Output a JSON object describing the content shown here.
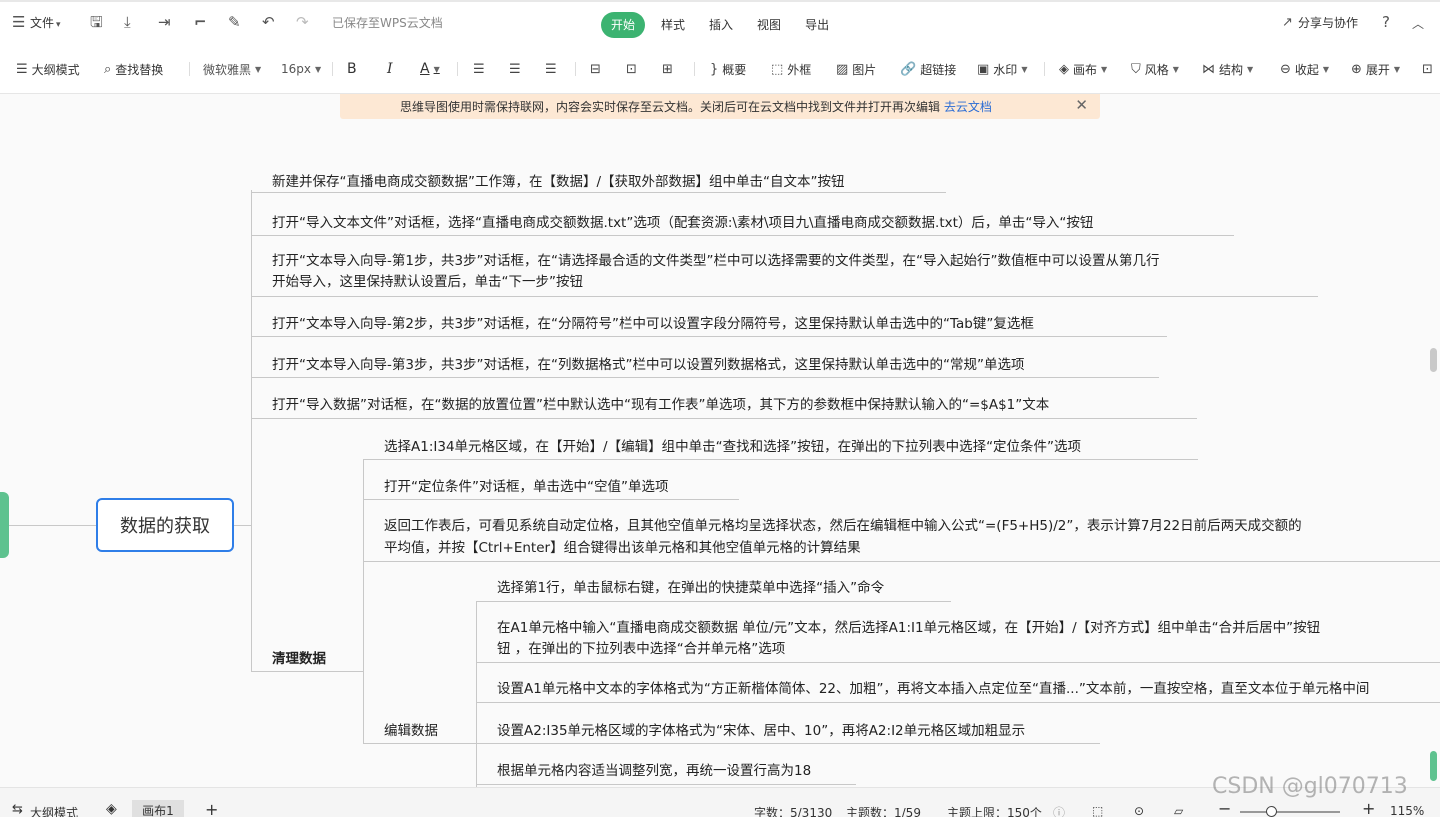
{
  "menubar": {
    "file_menu": "文件",
    "save_status": "已保存至WPS云文档",
    "tabs": [
      "开始",
      "样式",
      "插入",
      "视图",
      "导出"
    ],
    "share": "分享与协作"
  },
  "toolbar": {
    "outline_mode": "大纲模式",
    "find_replace": "查找替换",
    "font_name": "微软雅黑",
    "font_size": "16px",
    "bold": "B",
    "italic": "I",
    "font_color": "A",
    "summary": "概要",
    "frame": "外框",
    "image": "图片",
    "hyperlink": "超链接",
    "watermark": "水印",
    "canvas": "画布",
    "style": "风格",
    "structure": "结构",
    "collapse": "收起",
    "expand": "展开"
  },
  "notice": {
    "text": "思维导图使用时需保持联网，内容会实时保存至云文档。关闭后可在云文档中找到文件并打开再次编辑 ",
    "link": "去云文档"
  },
  "mindmap": {
    "root": "数据的获取",
    "level1_label": "清理数据",
    "level2_label": "编辑数据",
    "top_nodes": [
      "新建并保存“直播电商成交额数据”工作簿，在【数据】/【获取外部数据】组中单击“自文本”按钮",
      "打开“导入文本文件”对话框，选择“直播电商成交额数据.txt”选项（配套资源:\\素材\\项目九\\直播电商成交额数据.txt）后，单击“导入“按钮",
      "打开“文本导入向导-第1步，共3步”对话框，在“请选择最合适的文件类型”栏中可以选择需要的文件类型，在“导入起始行”数值框中可以设置从第几行",
      "开始导入，这里保持默认设置后，单击“下一步”按钮",
      "打开“文本导入向导-第2步，共3步”对话框，在“分隔符号”栏中可以设置字段分隔符号，这里保持默认单击选中的“Tab键”复选框",
      "打开“文本导入向导-第3步，共3步”对话框，在“列数据格式”栏中可以设置列数据格式，这里保持默认单击选中的“常规”单选项",
      "打开“导入数据”对话框，在“数据的放置位置”栏中默认选中“现有工作表”单选项，其下方的参数框中保持默认输入的“=$A$1”文本"
    ],
    "clean_nodes": [
      "选择A1:I34单元格区域，在【开始】/【编辑】组中单击“查找和选择”按钮，在弹出的下拉列表中选择“定位条件”选项",
      "打开“定位条件”对话框，单击选中“空值”单选项",
      "返回工作表后，可看见系统自动定位格，且其他空值单元格均呈选择状态，然后在编辑框中输入公式“=(F5+H5)/2”，表示计算7月22日前后两天成交额的",
      "平均值，并按【Ctrl+Enter】组合键得出该单元格和其他空值单元格的计算结果"
    ],
    "edit_nodes": [
      "选择第1行，单击鼠标右键，在弹出的快捷菜单中选择“插入”命令",
      "在A1单元格中输入“直播电商成交额数据 单位/元”文本，然后选择A1:I1单元格区域，在【开始】/【对齐方式】组中单击“合并后居中”按钮",
      "钮 ，在弹出的下拉列表中选择“合并单元格”选项",
      "设置A1单元格中文本的字体格式为“方正新楷体简体、22、加粗”，再将文本插入点定位至“直播...”文本前，一直按空格，直至文本位于单元格中间",
      "设置A2:I35单元格区域的字体格式为“宋体、居中、10”，再将A2:I2单元格区域加粗显示",
      "根据单元格内容适当调整列宽，再统一设置行高为18"
    ]
  },
  "statusbar": {
    "outline_mode": "大纲模式",
    "sheet": "画布1",
    "chars": "字数：5/3130",
    "topics": "主题数：1/59",
    "limit": "主题上限：150个",
    "zoom": "115%"
  },
  "watermark": "CSDN @gl070713"
}
